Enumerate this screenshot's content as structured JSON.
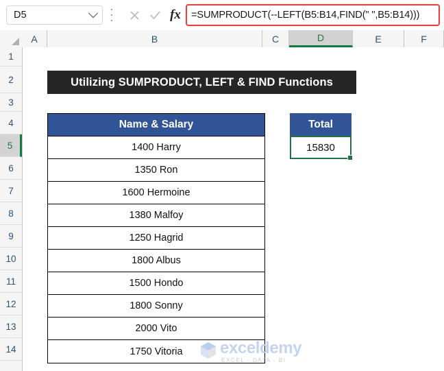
{
  "formula_bar": {
    "name_box_value": "D5",
    "formula": "=SUMPRODUCT(--LEFT(B5:B14,FIND(\" \",B5:B14)))",
    "cancel_icon": "close-icon",
    "enter_icon": "check-icon",
    "function_icon": "fx-icon",
    "chevron_icon": "chevron-down-icon",
    "more_icon": "kebab-menu-icon"
  },
  "grid": {
    "columns": [
      "A",
      "B",
      "C",
      "D",
      "E",
      "F"
    ],
    "active_column": "D",
    "rows": [
      "1",
      "2",
      "3",
      "4",
      "5",
      "6",
      "7",
      "8",
      "9",
      "10",
      "11",
      "12",
      "13",
      "14"
    ],
    "active_row": "5"
  },
  "title_banner": {
    "text": "Utilizing SUMPRODUCT, LEFT & FIND Functions"
  },
  "name_salary_table": {
    "header": "Name & Salary",
    "rows": [
      "1400 Harry",
      "1350 Ron",
      "1600 Hermoine",
      "1380 Malfoy",
      "1250 Hagrid",
      "1800 Albus",
      "1500 Hondo",
      "1800 Sonny",
      "2000 Vito",
      "1750 Vitoria"
    ]
  },
  "total_table": {
    "header": "Total",
    "value": "15830"
  },
  "watermark": {
    "name": "exceldemy",
    "tagline": "EXCEL - DATA - BI"
  },
  "colors": {
    "header_blue": "#305496",
    "banner_dark": "#262626",
    "selection_green": "#217346",
    "formula_highlight_red": "#ec3b3b"
  }
}
